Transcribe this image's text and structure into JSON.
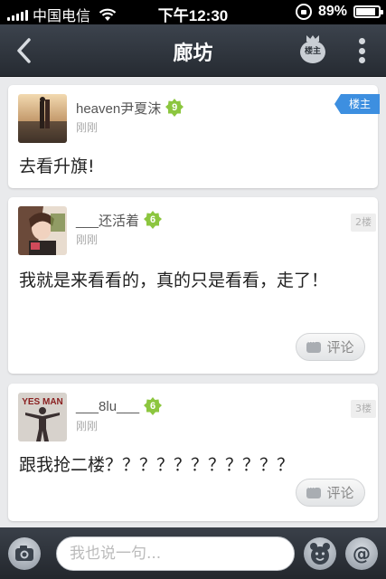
{
  "status_bar": {
    "carrier": "中国电信",
    "time": "下午12:30",
    "battery": "89%",
    "battery_level": 0.89
  },
  "nav": {
    "title": "廊坊",
    "owner_icon_label": "楼主",
    "back_icon": "chevron-left-icon",
    "more_icon": "more-vertical-icon"
  },
  "posts": [
    {
      "username": "heaven尹夏沫",
      "level": "9",
      "time": "刚刚",
      "content": "去看升旗!",
      "badge": "楼主"
    },
    {
      "username": "___还活着",
      "level": "6",
      "time": "刚刚",
      "content": "我就是来看看的，真的只是看看，走了！",
      "floor": "2楼",
      "comment_label": "评论"
    },
    {
      "username": "___8lu___",
      "level": "6",
      "time": "刚刚",
      "content": "跟我抢二楼？？？？？？？？？？？",
      "floor": "3楼",
      "comment_label": "评论",
      "avatar_text": "YES MAN"
    }
  ],
  "composer": {
    "placeholder": "我也说一句..."
  },
  "colors": {
    "nav_bg": "#2f353d",
    "owner_badge": "#3d8fe0",
    "level_badge": "#8cc63f"
  }
}
